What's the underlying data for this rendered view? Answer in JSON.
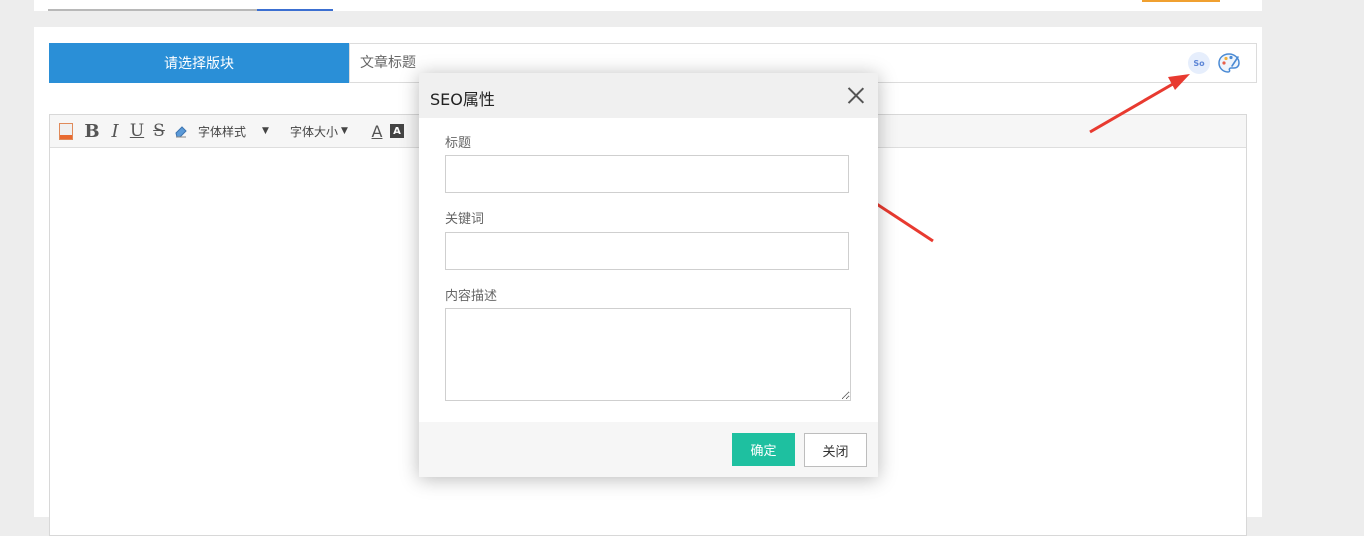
{
  "header": {
    "block_select_label": "请选择版块",
    "title_placeholder": "文章标题",
    "seo_icon_text": "So",
    "seo_icon": "seo-icon",
    "palette_icon": "palette-icon"
  },
  "toolbar": {
    "items": [
      {
        "name": "source-icon",
        "label": ""
      },
      {
        "name": "bold-button",
        "label": "B"
      },
      {
        "name": "italic-button",
        "label": "I"
      },
      {
        "name": "underline-button",
        "label": "U"
      },
      {
        "name": "strikethrough-button",
        "label": "S"
      },
      {
        "name": "eraser-icon",
        "label": ""
      }
    ],
    "font_style_label": "字体样式",
    "font_size_label": "字体大小",
    "font_color_label": "A",
    "bg_color_label": "A"
  },
  "modal": {
    "title": "SEO属性",
    "fields": {
      "title_label": "标题",
      "title_value": "",
      "keywords_label": "关键词",
      "keywords_value": "",
      "description_label": "内容描述",
      "description_value": ""
    },
    "ok_label": "确定",
    "close_label": "关闭"
  },
  "colors": {
    "primary_blue": "#2a8fd7",
    "confirm_green": "#1ec0a0",
    "annotation_red": "#e83a30",
    "background": "#ededed"
  }
}
